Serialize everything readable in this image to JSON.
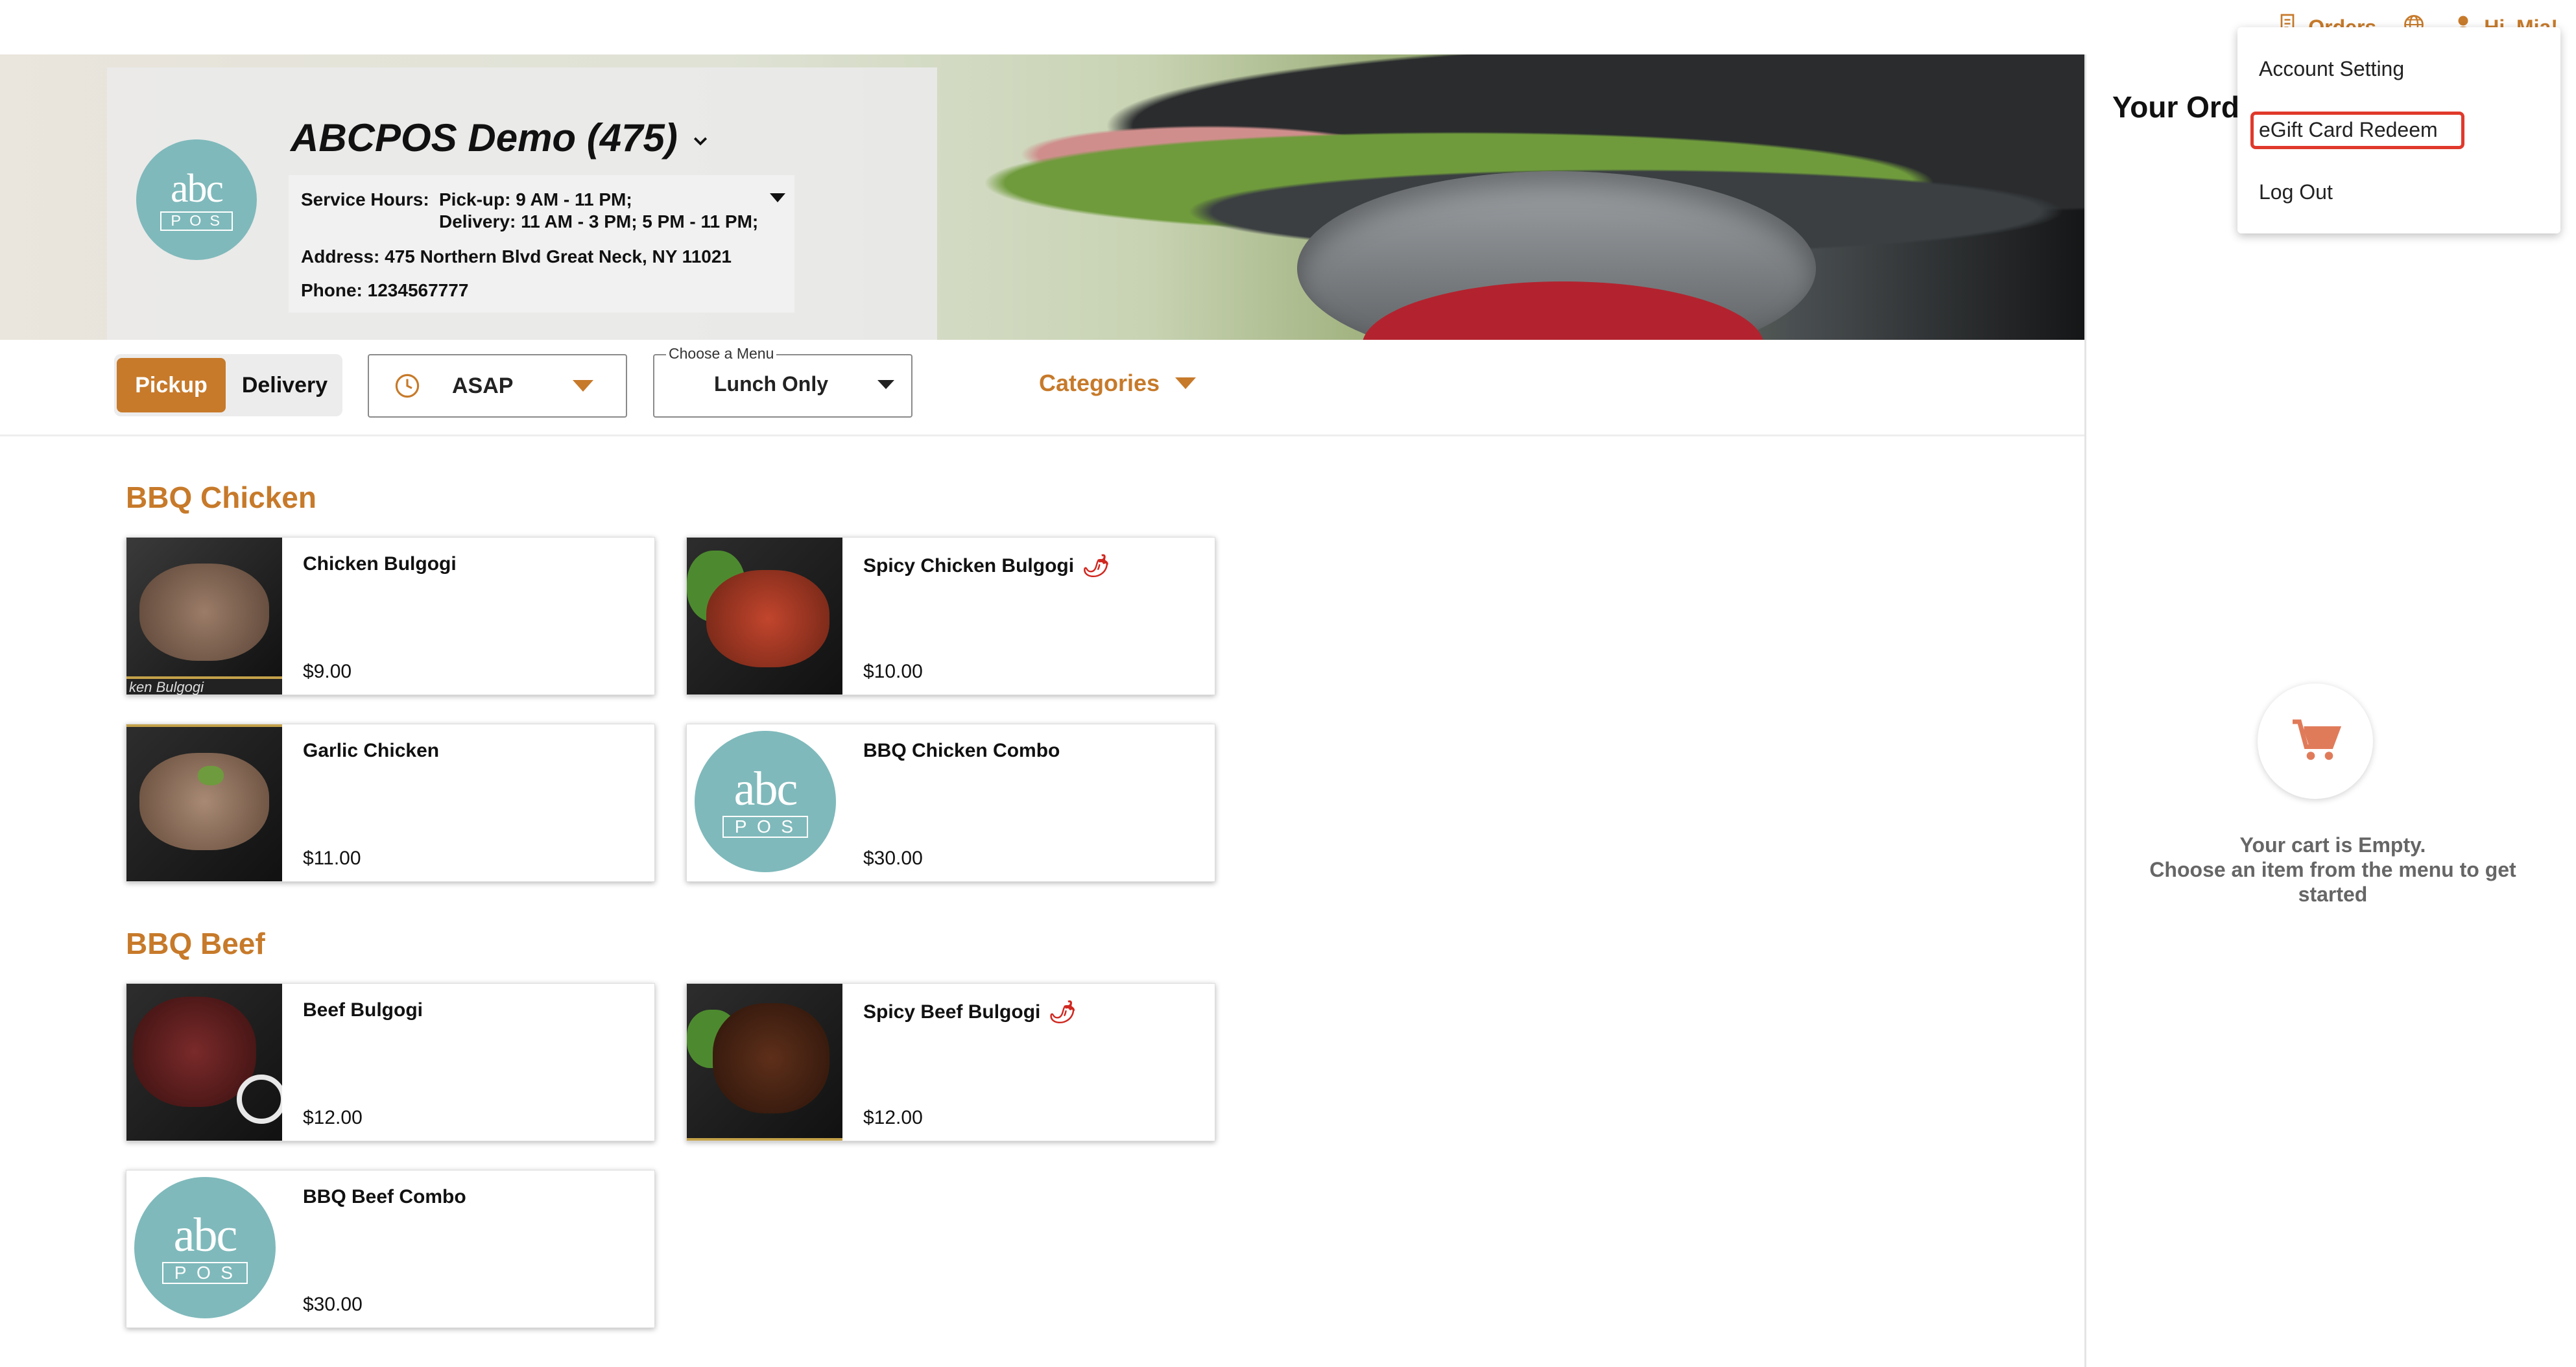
{
  "topbar": {
    "orders_label": "Orders",
    "user_greeting": "Hi, Mia!"
  },
  "store": {
    "logo_text": "abc",
    "logo_sub": "POS",
    "name": "ABCPOS Demo (475)",
    "hours_label": "Service Hours:",
    "pickup_hours": "Pick-up: 9 AM - 11 PM;",
    "delivery_hours": "Delivery: 11 AM - 3 PM; 5 PM - 11 PM;",
    "address": "Address: 475 Northern Blvd Great Neck, NY 11021",
    "phone": "Phone: 1234567777"
  },
  "controls": {
    "pickup_label": "Pickup",
    "delivery_label": "Delivery",
    "time_value": "ASAP",
    "menu_legend": "Choose a Menu",
    "menu_value": "Lunch Only",
    "categories_label": "Categories"
  },
  "menu": {
    "sections": [
      {
        "title": "BBQ Chicken",
        "items": [
          {
            "name": "Chicken Bulgogi",
            "price": "$9.00",
            "spicy": false
          },
          {
            "name": "Spicy Chicken Bulgogi",
            "price": "$10.00",
            "spicy": true
          },
          {
            "name": "Garlic Chicken",
            "price": "$11.00",
            "spicy": false
          },
          {
            "name": "BBQ Chicken Combo",
            "price": "$30.00",
            "spicy": false
          }
        ]
      },
      {
        "title": "BBQ Beef",
        "items": [
          {
            "name": "Beef Bulgogi",
            "price": "$12.00",
            "spicy": false
          },
          {
            "name": "Spicy Beef Bulgogi",
            "price": "$12.00",
            "spicy": true
          },
          {
            "name": "BBQ Beef Combo",
            "price": "$30.00",
            "spicy": false
          }
        ]
      }
    ],
    "thumb_caption": "ken Bulgogi"
  },
  "cart": {
    "title": "Your Ord",
    "empty_line1": "Your cart is Empty.",
    "empty_line2": "Choose an item from the menu to get started"
  },
  "dropdown": {
    "items": [
      "Account Setting",
      "eGift Card Redeem",
      "Log Out"
    ]
  },
  "colors": {
    "accent": "#c77a2a",
    "logo": "#7fb9bb",
    "highlight": "#e0392b"
  }
}
